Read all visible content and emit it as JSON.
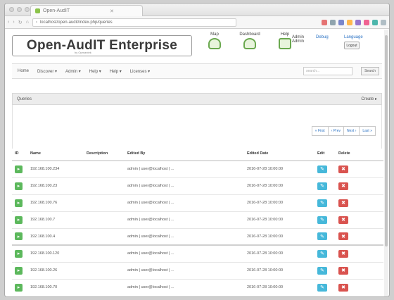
{
  "browser": {
    "tab_title": "Open-AudIT",
    "url": "localhost/open-audit/index.php/queries"
  },
  "header": {
    "logo_text": "Open-AudIT Enterprise",
    "logo_subtext": "by Opmantek",
    "icons": [
      {
        "label": "Map",
        "icon": "map-icon"
      },
      {
        "label": "Dashboard",
        "icon": "dashboard-icon"
      },
      {
        "label": "Help",
        "icon": "help-icon"
      }
    ],
    "user_name": "Admin",
    "user_sub": "Admin",
    "user_link": "Debug",
    "lang_link": "Language",
    "logout_label": "Logout"
  },
  "nav": {
    "items": [
      "Home",
      "Discover ▾",
      "Admin ▾",
      "Help ▾",
      "Help ▾",
      "Licenses ▾"
    ],
    "search_placeholder": "search...",
    "search_button": "Search"
  },
  "panel": {
    "title": "Queries",
    "right_label": "Create ▸"
  },
  "pager": {
    "items": [
      "« First",
      "‹ Prev",
      "Next ›",
      "Last »"
    ]
  },
  "table": {
    "headers": [
      "ID",
      "Name",
      "Description",
      "Edited By",
      "Edited Date",
      "Edit",
      "Delete"
    ],
    "rows": [
      {
        "id": "",
        "name": "192.168.100.234",
        "description": "",
        "edited_by": "admin | user@localhost | ...",
        "edited_date": "2016-07-28 10:00:00"
      },
      {
        "id": "",
        "name": "192.168.100.23",
        "description": "",
        "edited_by": "admin | user@localhost | ...",
        "edited_date": "2016-07-28 10:00:00"
      },
      {
        "id": "",
        "name": "192.168.100.76",
        "description": "",
        "edited_by": "admin | user@localhost | ...",
        "edited_date": "2016-07-28 10:00:00"
      },
      {
        "id": "",
        "name": "192.168.100.7",
        "description": "",
        "edited_by": "admin | user@localhost | ...",
        "edited_date": "2016-07-28 10:00:00"
      },
      {
        "id": "",
        "name": "192.168.100.4",
        "description": "",
        "edited_by": "admin | user@localhost | ...",
        "edited_date": "2016-07-28 10:00:00"
      },
      {
        "id": "",
        "name": "192.168.100.120",
        "description": "",
        "edited_by": "admin | user@localhost | ...",
        "edited_date": "2016-07-28 10:00:00"
      },
      {
        "id": "",
        "name": "192.168.100.26",
        "description": "",
        "edited_by": "admin | user@localhost | ...",
        "edited_date": "2016-07-28 10:00:00"
      },
      {
        "id": "",
        "name": "192.168.100.70",
        "description": "",
        "edited_by": "admin | user@localhost | ...",
        "edited_date": "2016-07-28 10:00:00"
      }
    ]
  },
  "colors": {
    "view_button": "#5cb85c",
    "edit_button": "#46b8da",
    "delete_button": "#d9534f"
  }
}
